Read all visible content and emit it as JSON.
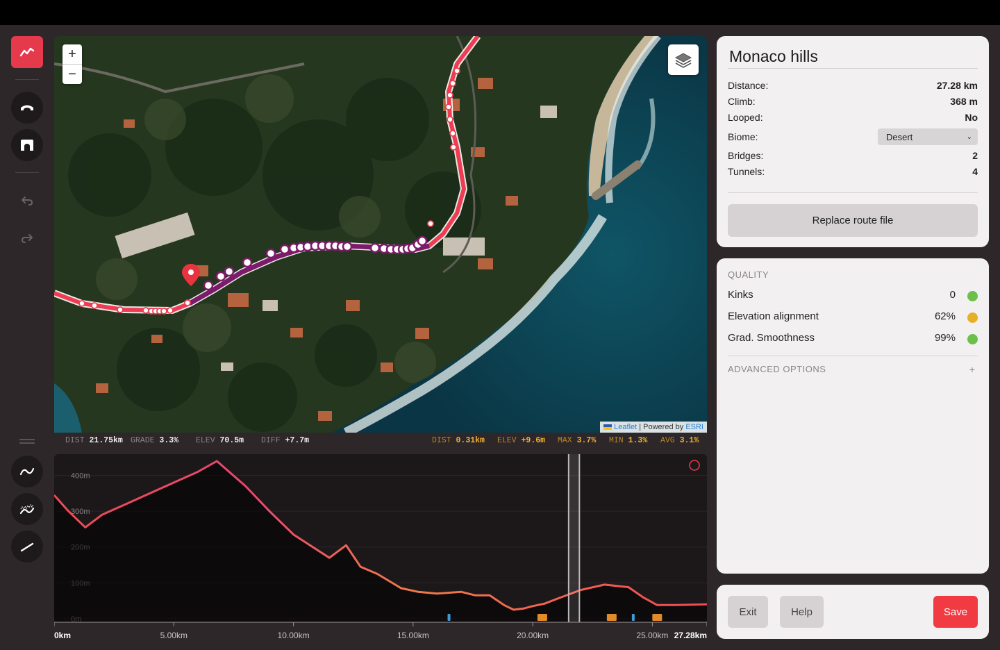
{
  "toolbar": {
    "tools": [
      "profile-tool",
      "bridge-tool",
      "tunnel-tool",
      "undo",
      "redo",
      "smooth-curve",
      "smooth-noise",
      "straight-line"
    ]
  },
  "map": {
    "zoom_in": "+",
    "zoom_out": "−",
    "attribution_leaflet": "Leaflet",
    "attribution_sep": " | Powered by ",
    "attribution_esri": "ESRI"
  },
  "stats_left": [
    {
      "k": "DIST",
      "v": "21.75km"
    },
    {
      "k": "GRADE",
      "v": "3.3%"
    },
    {
      "k": "ELEV",
      "v": "70.5m"
    },
    {
      "k": "DIFF",
      "v": "+7.7m"
    }
  ],
  "stats_right": [
    {
      "k": "DIST",
      "v": "0.31km"
    },
    {
      "k": "ELEV",
      "v": "+9.6m"
    },
    {
      "k": "MAX",
      "v": "3.7%"
    },
    {
      "k": "MIN",
      "v": "1.3%"
    },
    {
      "k": "AVG",
      "v": "3.1%"
    }
  ],
  "chart_data": {
    "type": "area",
    "xlabel": "",
    "ylabel": "",
    "x_ticks": [
      "0km",
      "5.00km",
      "10.00km",
      "15.00km",
      "20.00km",
      "25.00km",
      "27.28km"
    ],
    "y_ticks": [
      "400m",
      "300m",
      "200m",
      "100m",
      "0m"
    ],
    "xlim": [
      0,
      27.28
    ],
    "ylim": [
      -10,
      440
    ],
    "series": [
      {
        "x": [
          0,
          0.6,
          1.3,
          2,
          3,
          4,
          5,
          6,
          6.8,
          8,
          9,
          10,
          11.5,
          12.2,
          12.8,
          13.5,
          14.5,
          15.2,
          16,
          17,
          17.6,
          18.2,
          18.8,
          19.2,
          19.6,
          20,
          20.5,
          21,
          22,
          23,
          24,
          24.6,
          25.2,
          26,
          27.28
        ],
        "y": [
          345,
          300,
          255,
          290,
          320,
          350,
          380,
          410,
          440,
          370,
          300,
          235,
          170,
          205,
          145,
          125,
          85,
          75,
          70,
          75,
          65,
          65,
          38,
          25,
          28,
          35,
          42,
          55,
          80,
          95,
          88,
          60,
          38,
          38,
          40
        ]
      }
    ],
    "grid": true,
    "selection_km": [
      21.5,
      21.95
    ],
    "markers": [
      {
        "km": 16.5,
        "color": "#3f9ad9"
      },
      {
        "km": 20.4,
        "color": "#e08a2a"
      },
      {
        "km": 23.3,
        "color": "#e08a2a"
      },
      {
        "km": 24.2,
        "color": "#3f9ad9"
      },
      {
        "km": 25.2,
        "color": "#e08a2a"
      }
    ]
  },
  "route": {
    "name": "Monaco hills",
    "distance_label": "Distance:",
    "distance": "27.28 km",
    "climb_label": "Climb:",
    "climb": "368 m",
    "looped_label": "Looped:",
    "looped": "No",
    "biome_label": "Biome:",
    "biome": "Desert",
    "bridges_label": "Bridges:",
    "bridges": "2",
    "tunnels_label": "Tunnels:",
    "tunnels": "4",
    "replace_label": "Replace route file"
  },
  "quality": {
    "heading": "QUALITY",
    "items": [
      {
        "label": "Kinks",
        "value": "0",
        "color": "#6cc04a"
      },
      {
        "label": "Elevation alignment",
        "value": "62%",
        "color": "#e5b02a"
      },
      {
        "label": "Grad. Smoothness",
        "value": "99%",
        "color": "#6cc04a"
      }
    ],
    "advanced_label": "ADVANCED OPTIONS",
    "advanced_icon": "+"
  },
  "footer": {
    "exit": "Exit",
    "help": "Help",
    "save": "Save",
    "save_color": "#f23a42"
  }
}
